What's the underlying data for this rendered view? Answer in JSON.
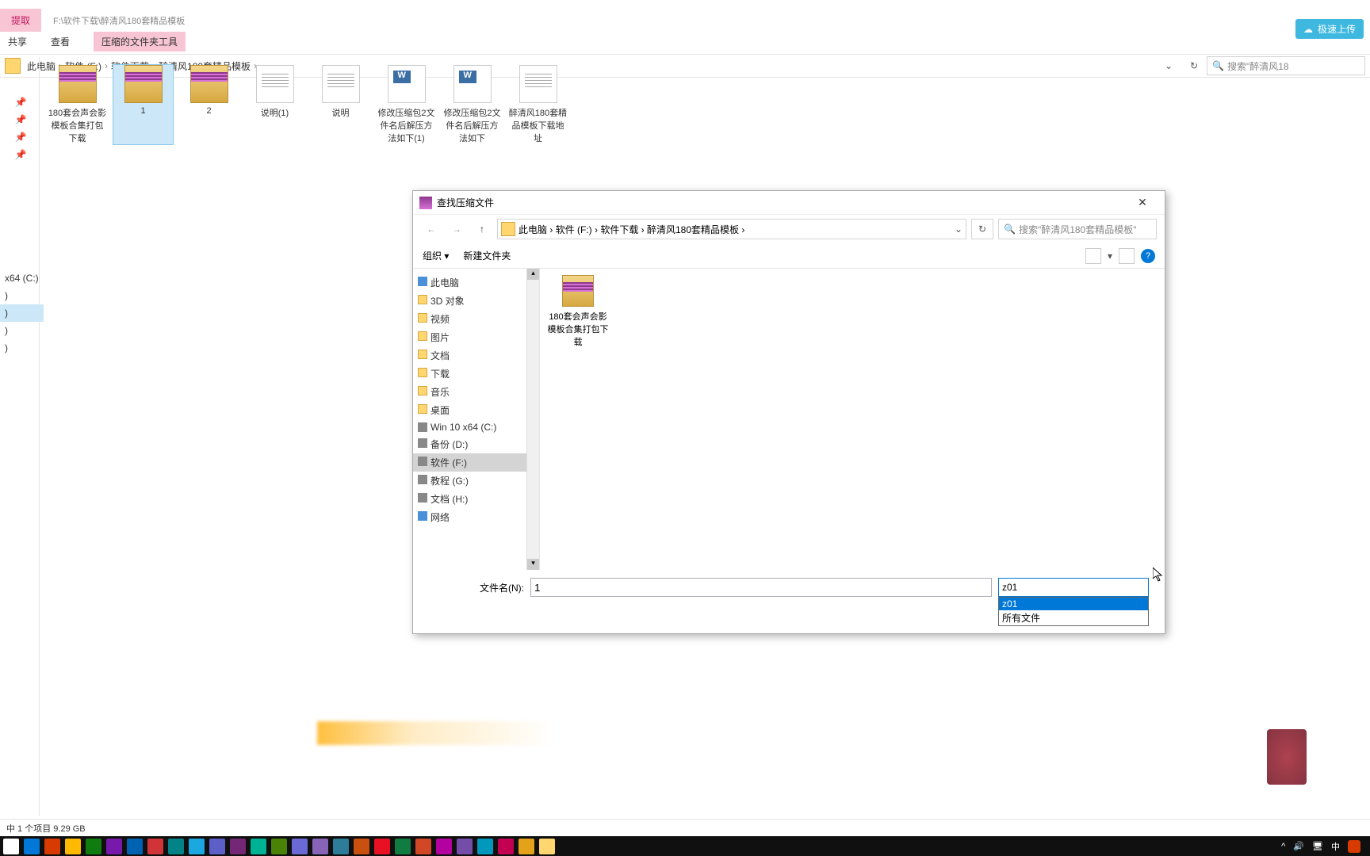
{
  "ribbon": {
    "extract": "提取",
    "path_small": "F:\\软件下载\\醉清风180套精品模板",
    "share": "共享",
    "view": "查看",
    "compress_tools": "压缩的文件夹工具"
  },
  "upload_button": "极速上传",
  "breadcrumb": {
    "items": [
      "此电脑",
      "软件 (F:)",
      "软件下载",
      "醉清风180套精品模板"
    ]
  },
  "main_search_placeholder": "搜索\"醉清风18",
  "files": [
    {
      "name": "180套会声会影模板合集打包下载",
      "type": "rar"
    },
    {
      "name": "1",
      "type": "rar",
      "selected": true
    },
    {
      "name": "2",
      "type": "rar"
    },
    {
      "name": "说明(1)",
      "type": "txt"
    },
    {
      "name": "说明",
      "type": "txt"
    },
    {
      "name": "修改压缩包2文件名后解压方法如下(1)",
      "type": "doc"
    },
    {
      "name": "修改压缩包2文件名后解压方法如下",
      "type": "doc"
    },
    {
      "name": "醉清风180套精品模板下载地址",
      "type": "txt"
    }
  ],
  "left_panel": {
    "drive": "x64 (C:)",
    "entries": [
      ")",
      ")",
      ")",
      ")"
    ]
  },
  "dialog": {
    "title": "查找压缩文件",
    "breadcrumb": [
      "此电脑",
      "软件 (F:)",
      "软件下载",
      "醉清风180套精品模板"
    ],
    "search_placeholder": "搜索\"醉清风180套精品模板\"",
    "organize": "组织 ▾",
    "new_folder": "新建文件夹",
    "tree": [
      {
        "label": "此电脑",
        "icon": "pc"
      },
      {
        "label": "3D 对象",
        "icon": "folder"
      },
      {
        "label": "视频",
        "icon": "folder"
      },
      {
        "label": "图片",
        "icon": "folder"
      },
      {
        "label": "文档",
        "icon": "folder"
      },
      {
        "label": "下载",
        "icon": "folder"
      },
      {
        "label": "音乐",
        "icon": "folder"
      },
      {
        "label": "桌面",
        "icon": "folder"
      },
      {
        "label": "Win 10 x64 (C:)",
        "icon": "drive"
      },
      {
        "label": "备份 (D:)",
        "icon": "drive"
      },
      {
        "label": "软件 (F:)",
        "icon": "drive",
        "selected": true
      },
      {
        "label": "教程 (G:)",
        "icon": "drive"
      },
      {
        "label": "文档 (H:)",
        "icon": "drive"
      },
      {
        "label": "网络",
        "icon": "pc"
      }
    ],
    "dlg_file": "180套会声会影模板合集打包下载",
    "filename_label": "文件名(N):",
    "filename_value": "1",
    "filetype_value": "z01",
    "filetype_options": [
      "z01",
      "所有文件"
    ]
  },
  "status_bar": "中 1 个项目  9.29 GB",
  "taskbar_colors": [
    "#fff",
    "#0078d7",
    "#d83b01",
    "#ffb900",
    "#107c10",
    "#7719aa",
    "#0063b1",
    "#d13438",
    "#038387",
    "#1ba8e0",
    "#5b5fc7",
    "#742774",
    "#00b294",
    "#498205",
    "#6b69d6",
    "#8764b8",
    "#2d7d9a",
    "#ca5010",
    "#e81123",
    "#107c41",
    "#d24726",
    "#b4009e",
    "#744da9",
    "#0099bc",
    "#c30052",
    "#e3a21a",
    "#ffd670"
  ],
  "tray": {
    "ime": "中"
  }
}
